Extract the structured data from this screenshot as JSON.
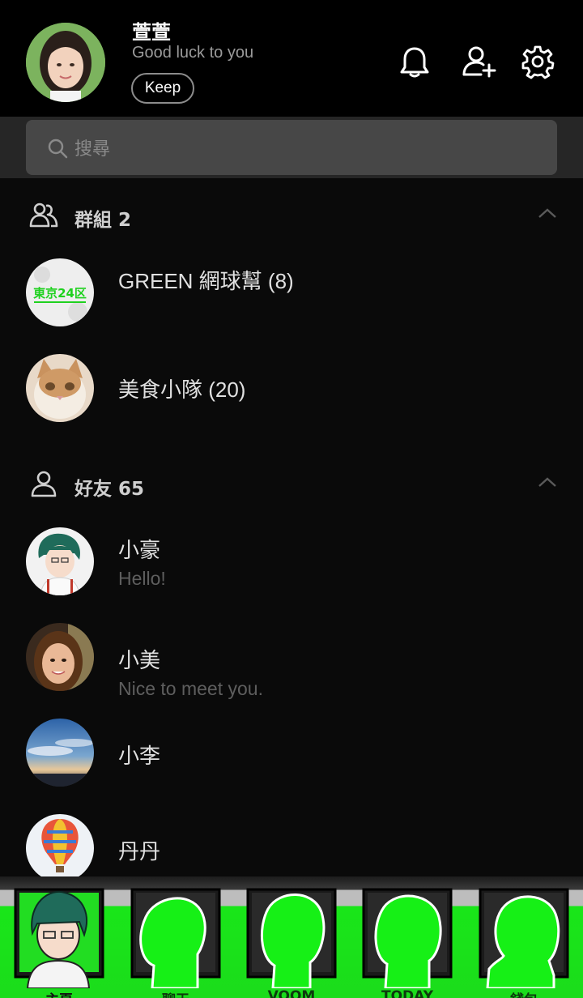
{
  "profile": {
    "name": "萱萱",
    "status": "Good luck to you",
    "keep_label": "Keep"
  },
  "header_icons": [
    "bell-icon",
    "add-friend-icon",
    "settings-icon"
  ],
  "search": {
    "placeholder": "搜尋"
  },
  "groups": {
    "label": "群組 2",
    "items": [
      {
        "name": "GREEN 網球幫 (8)",
        "avatar_text": "東京24区"
      },
      {
        "name": "美食小隊 (20)"
      }
    ]
  },
  "friends": {
    "label": "好友 65",
    "items": [
      {
        "name": "小豪",
        "message": "Hello!"
      },
      {
        "name": "小美",
        "message": "Nice to meet you."
      },
      {
        "name": "小李",
        "message": ""
      },
      {
        "name": "丹丹",
        "message": ""
      }
    ]
  },
  "tabs": [
    {
      "label": "主頁",
      "active": true
    },
    {
      "label": "聊天",
      "active": false
    },
    {
      "label": "VOOM",
      "active": false
    },
    {
      "label": "TODAY",
      "active": false
    },
    {
      "label": "錢包",
      "active": false
    }
  ],
  "colors": {
    "accent": "#19e619",
    "background": "#0a0a0a"
  }
}
